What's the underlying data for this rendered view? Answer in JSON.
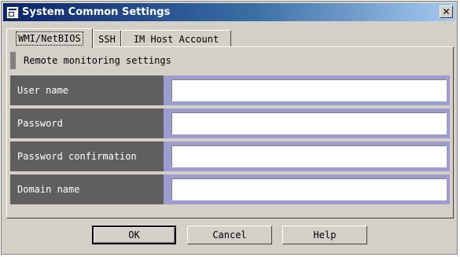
{
  "window": {
    "title": "System Common Settings",
    "icons": {
      "app": "settings-app-icon",
      "close": "close-icon"
    },
    "close_glyph": "✕"
  },
  "tabs": [
    {
      "label": "WMI/NetBIOS",
      "active": true
    },
    {
      "label": "SSH",
      "active": false
    },
    {
      "label": "IM Host Account",
      "active": false
    }
  ],
  "section": {
    "label": "Remote monitoring settings"
  },
  "fields": [
    {
      "label": "User name",
      "value": "",
      "placeholder": ""
    },
    {
      "label": "Password",
      "value": "",
      "placeholder": ""
    },
    {
      "label": "Password confirmation",
      "value": "",
      "placeholder": ""
    },
    {
      "label": "Domain name",
      "value": "",
      "placeholder": ""
    }
  ],
  "buttons": {
    "ok": "OK",
    "cancel": "Cancel",
    "help": "Help"
  },
  "colors": {
    "titlebar_start": "#0a246a",
    "label_background": "#5f5f5f",
    "field_frame": "#9c9ccf",
    "dialog_face": "#d4d0c8"
  }
}
